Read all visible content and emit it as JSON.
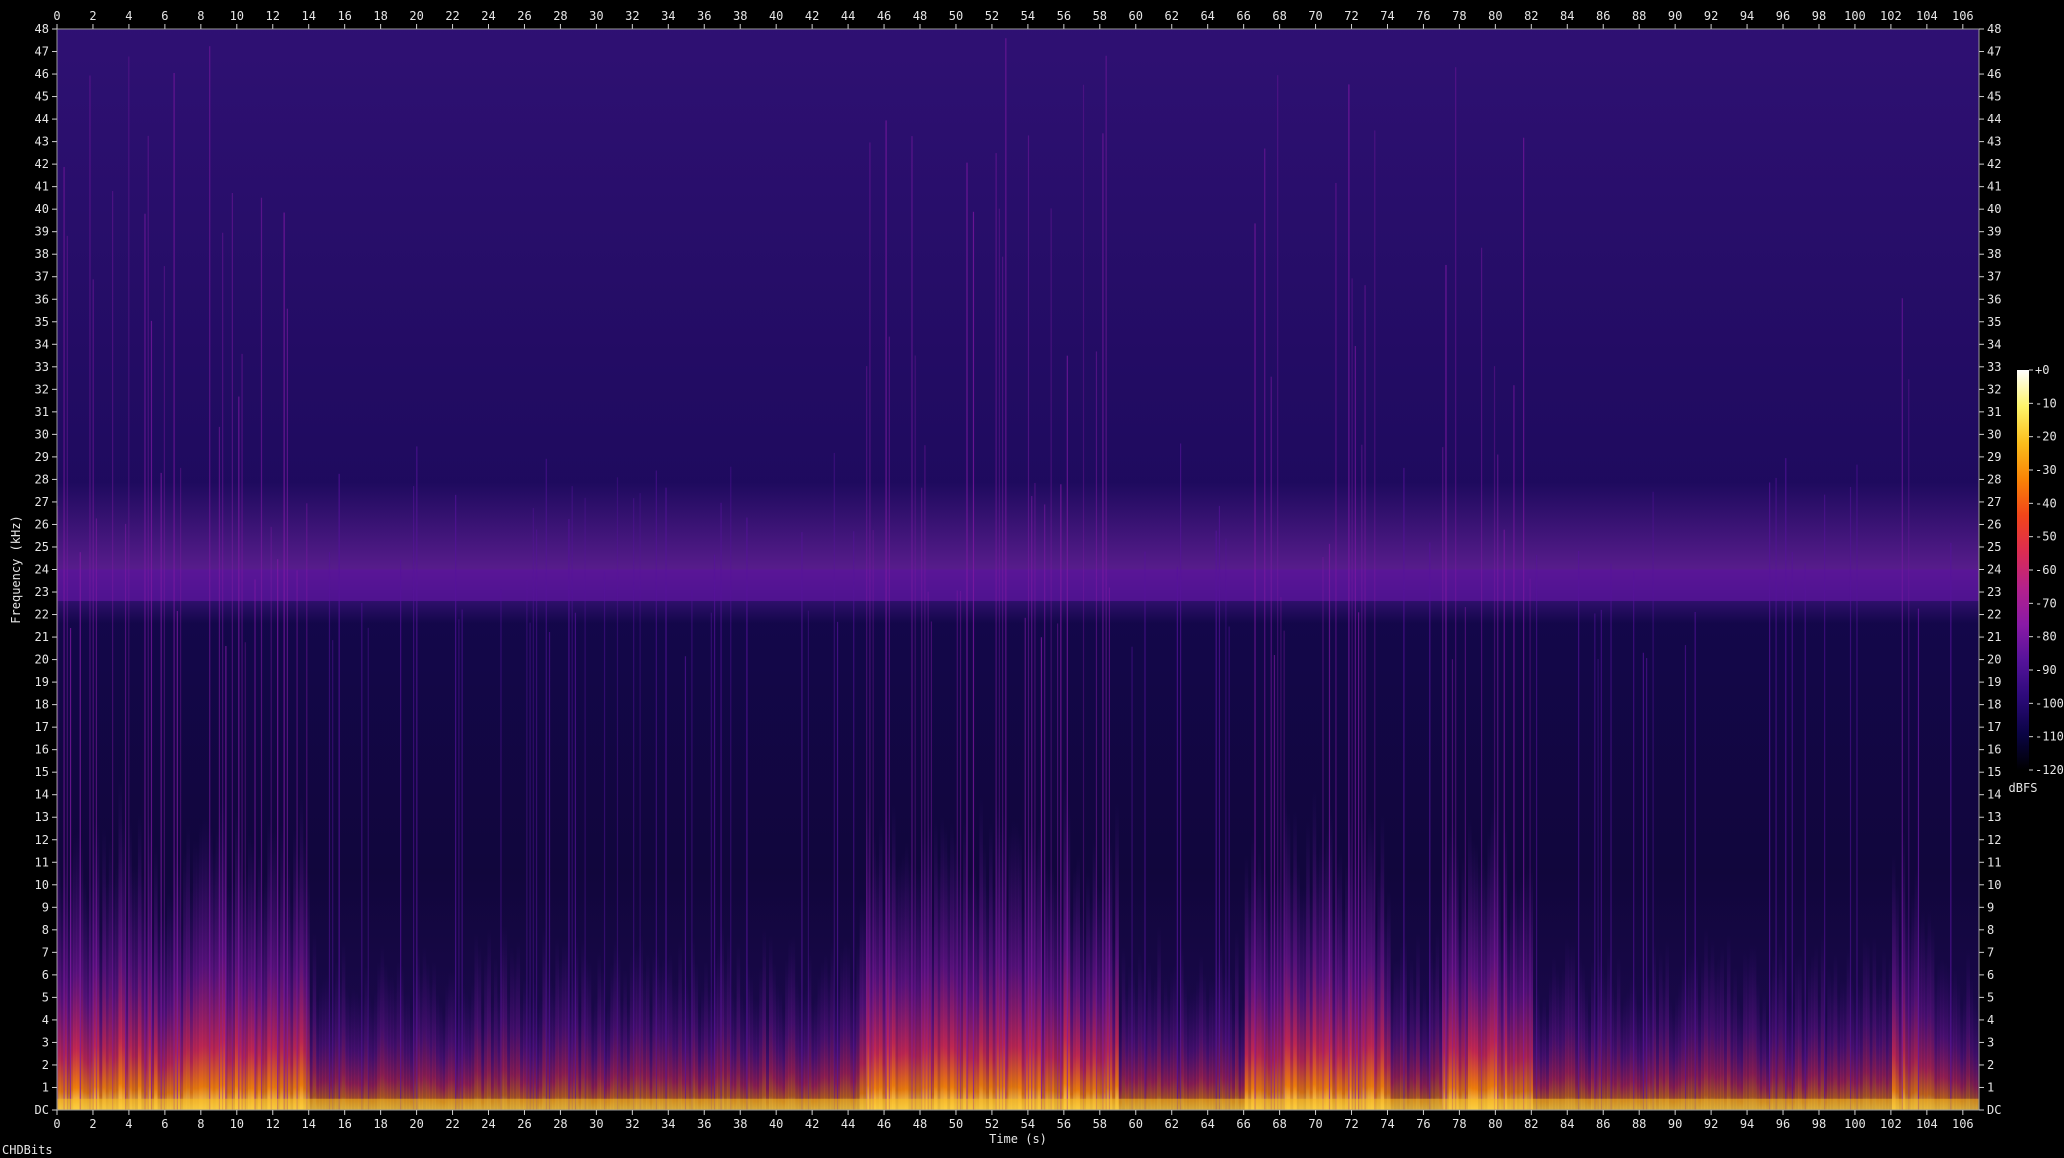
{
  "chart_data": {
    "type": "heatmap",
    "title": "",
    "xlabel": "Time (s)",
    "ylabel": "Frequency (kHz)",
    "x_range": [
      0,
      106.9
    ],
    "y_range": [
      0,
      48
    ],
    "x_ticks": [
      "0",
      "2",
      "4",
      "6",
      "8",
      "10",
      "12",
      "14",
      "16",
      "18",
      "20",
      "22",
      "24",
      "26",
      "28",
      "30",
      "32",
      "34",
      "36",
      "38",
      "40",
      "42",
      "44",
      "46",
      "48",
      "50",
      "52",
      "54",
      "56",
      "58",
      "60",
      "62",
      "64",
      "66",
      "68",
      "70",
      "72",
      "74",
      "76",
      "78",
      "80",
      "82",
      "84",
      "86",
      "88",
      "90",
      "92",
      "94",
      "96",
      "98",
      "100",
      "102",
      "104",
      "106"
    ],
    "y_ticks": [
      "DC",
      "1",
      "2",
      "3",
      "4",
      "5",
      "6",
      "7",
      "8",
      "9",
      "10",
      "11",
      "12",
      "13",
      "14",
      "15",
      "16",
      "17",
      "18",
      "19",
      "20",
      "21",
      "22",
      "23",
      "24",
      "25",
      "26",
      "27",
      "28",
      "29",
      "30",
      "31",
      "32",
      "33",
      "34",
      "35",
      "36",
      "37",
      "38",
      "39",
      "40",
      "41",
      "42",
      "43",
      "44",
      "45",
      "46",
      "47",
      "48"
    ],
    "colorbar": {
      "unit": "dBFS",
      "range": [
        -120,
        0
      ],
      "ticks": [
        "+0",
        "-10",
        "-20",
        "-30",
        "-40",
        "-50",
        "-60",
        "-70",
        "-80",
        "-90",
        "-100",
        "-110",
        "-120"
      ],
      "colors": [
        "#000000",
        "#0a0445",
        "#2c0a7a",
        "#55139a",
        "#8a1aa6",
        "#b4218c",
        "#dc2c52",
        "#f2451a",
        "#f98406",
        "#fbbe1c",
        "#fdf46a",
        "#ffffff"
      ]
    },
    "background_level_dbfs": -95,
    "upper_band_level_dbfs": -92,
    "band_23_24k_level_dbfs": -86,
    "loud_segments_s": [
      [
        0,
        14
      ],
      [
        44.5,
        59
      ],
      [
        66,
        74
      ],
      [
        77,
        82
      ]
    ],
    "decay_tail_s": [
      102,
      107
    ]
  },
  "footer": {
    "label": "CHDBits"
  }
}
